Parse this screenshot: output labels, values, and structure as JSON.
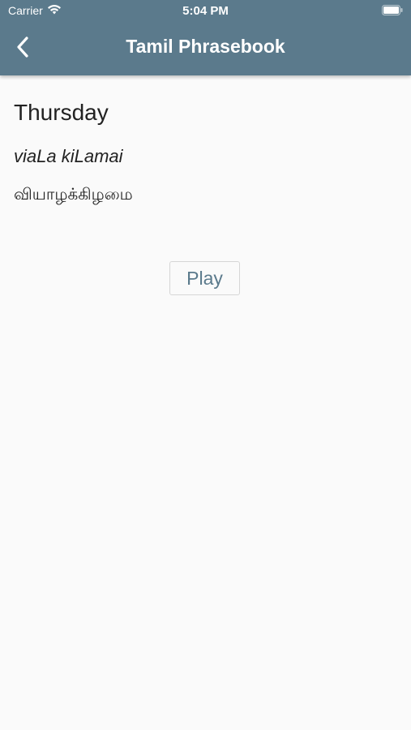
{
  "status_bar": {
    "carrier": "Carrier",
    "time": "5:04 PM",
    "wifi_icon": "wifi-icon",
    "battery_icon": "battery-icon"
  },
  "nav": {
    "title": "Tamil Phrasebook",
    "back_icon": "chevron-left-icon"
  },
  "phrase": {
    "english": "Thursday",
    "transliteration": "viaLa kiLamai",
    "tamil": "வியாழக்கிழமை"
  },
  "actions": {
    "play_label": "Play"
  },
  "colors": {
    "header_bg": "#5b7a8c",
    "page_bg": "#fafafa",
    "accent": "#5b7a8c"
  }
}
